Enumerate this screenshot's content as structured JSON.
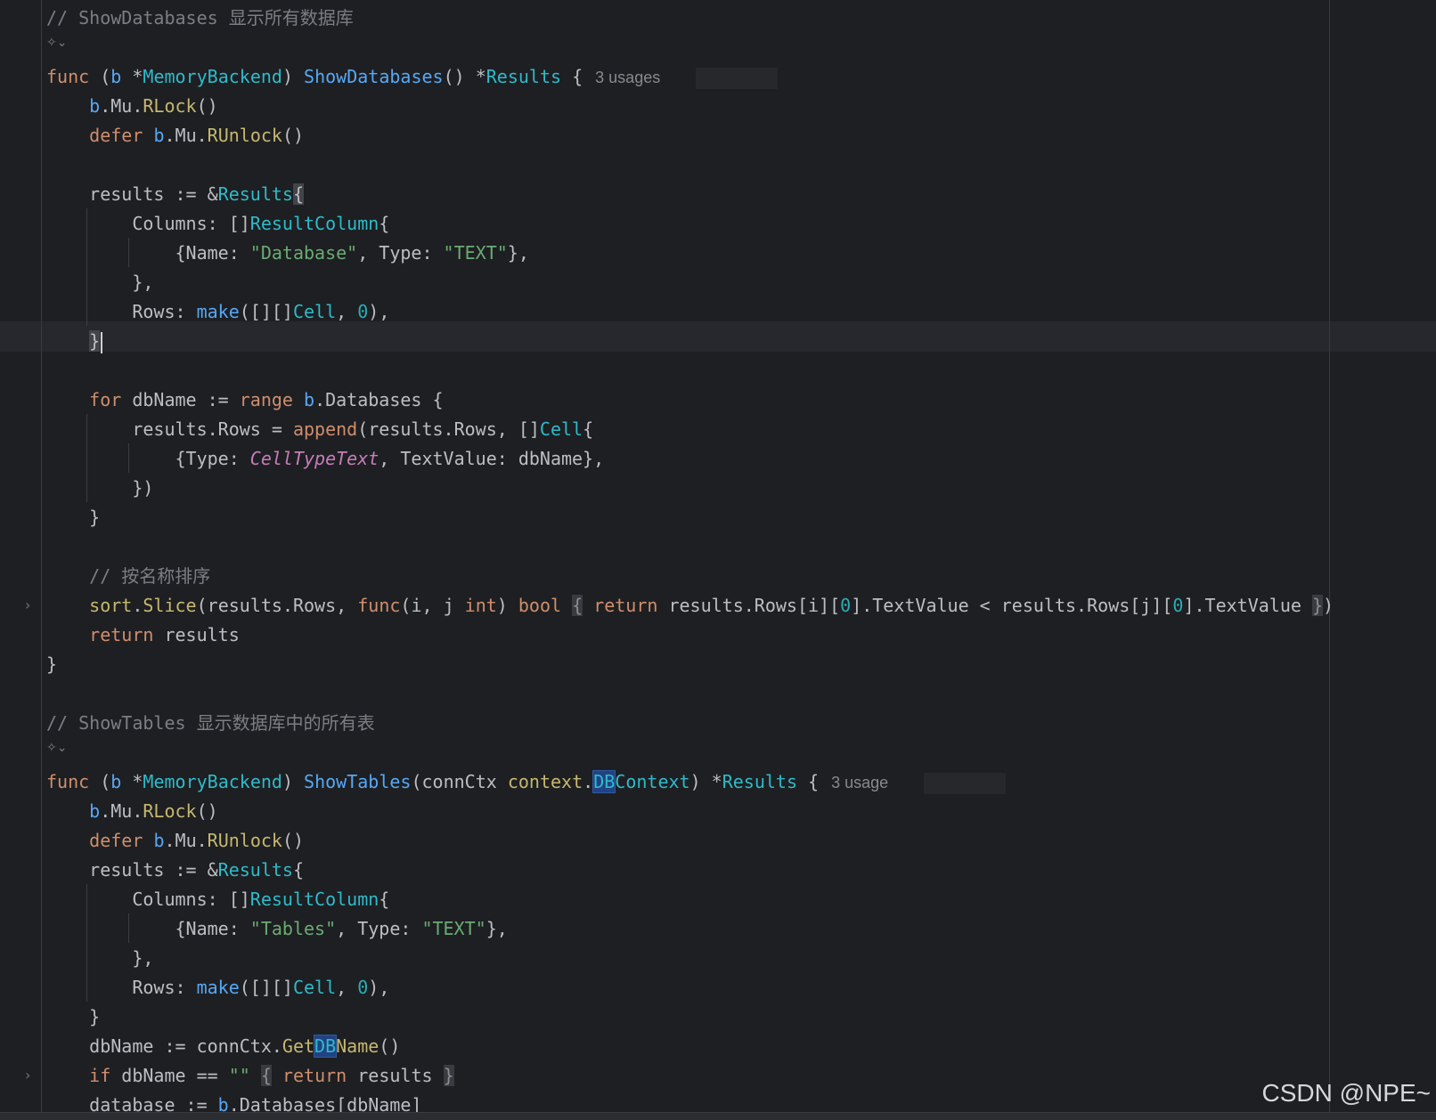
{
  "editor": {
    "lines": [
      {
        "t": 0,
        "cls": "cmt",
        "text": "// ShowDatabases 显示所有数据库"
      },
      {
        "t": 2,
        "seg": [
          [
            "kw",
            "func"
          ],
          [
            "p",
            " ("
          ],
          [
            "rcv",
            "b"
          ],
          [
            "p",
            " *"
          ],
          [
            "ty",
            "MemoryBackend"
          ],
          [
            "p",
            ") "
          ],
          [
            "fn",
            "ShowDatabases"
          ],
          [
            "p",
            "() *"
          ],
          [
            "ty",
            "Results"
          ],
          [
            "p",
            " {"
          ]
        ],
        "hint": "3 usages"
      },
      {
        "t": 3,
        "seg": [
          [
            "p",
            "    "
          ],
          [
            "rcv",
            "b"
          ],
          [
            "p",
            ".Mu."
          ],
          [
            "mc",
            "RLock"
          ],
          [
            "p",
            "()"
          ]
        ]
      },
      {
        "t": 4,
        "seg": [
          [
            "p",
            "    "
          ],
          [
            "kw",
            "defer"
          ],
          [
            "p",
            " "
          ],
          [
            "rcv",
            "b"
          ],
          [
            "p",
            ".Mu."
          ],
          [
            "mc",
            "RUnlock"
          ],
          [
            "p",
            "()"
          ]
        ]
      },
      {
        "t": 6,
        "seg": [
          [
            "p",
            "    results := &"
          ],
          [
            "ty",
            "Results"
          ],
          [
            "bh",
            "{"
          ]
        ]
      },
      {
        "t": 7,
        "seg": [
          [
            "p",
            "        Columns: []"
          ],
          [
            "ty",
            "ResultColumn"
          ],
          [
            "p",
            "{"
          ]
        ]
      },
      {
        "t": 8,
        "seg": [
          [
            "p",
            "            {Name: "
          ],
          [
            "str",
            "\"Database\""
          ],
          [
            "p",
            ", Type: "
          ],
          [
            "str",
            "\"TEXT\""
          ],
          [
            "p",
            "},"
          ]
        ]
      },
      {
        "t": 9,
        "seg": [
          [
            "p",
            "        },"
          ]
        ]
      },
      {
        "t": 10,
        "seg": [
          [
            "p",
            "        Rows: "
          ],
          [
            "bi",
            "make"
          ],
          [
            "p",
            "([][]"
          ],
          [
            "ty",
            "Cell"
          ],
          [
            "p",
            ", "
          ],
          [
            "num",
            "0"
          ],
          [
            "p",
            "),"
          ]
        ]
      },
      {
        "t": 11,
        "seg": [
          [
            "p",
            "    "
          ],
          [
            "bh",
            "}"
          ]
        ],
        "caret": true
      },
      {
        "t": 13,
        "seg": [
          [
            "p",
            "    "
          ],
          [
            "kw",
            "for"
          ],
          [
            "p",
            " dbName := "
          ],
          [
            "kw",
            "range"
          ],
          [
            "p",
            " "
          ],
          [
            "rcv",
            "b"
          ],
          [
            "p",
            ".Databases {"
          ]
        ]
      },
      {
        "t": 14,
        "seg": [
          [
            "p",
            "        results.Rows = "
          ],
          [
            "ap",
            "append"
          ],
          [
            "p",
            "(results.Rows, []"
          ],
          [
            "ty",
            "Cell"
          ],
          [
            "p",
            "{"
          ]
        ]
      },
      {
        "t": 15,
        "seg": [
          [
            "p",
            "            {Type: "
          ],
          [
            "cnst",
            "CellTypeText"
          ],
          [
            "p",
            ", TextValue: dbName},"
          ]
        ]
      },
      {
        "t": 16,
        "seg": [
          [
            "p",
            "        })"
          ]
        ]
      },
      {
        "t": 17,
        "seg": [
          [
            "p",
            "    }"
          ]
        ]
      },
      {
        "t": 19,
        "seg": [
          [
            "p",
            "    "
          ],
          [
            "cmt",
            "// 按名称排序"
          ]
        ]
      },
      {
        "t": 20,
        "fold": true,
        "seg": [
          [
            "p",
            "    "
          ],
          [
            "pkg",
            "sort"
          ],
          [
            "p",
            "."
          ],
          [
            "mc",
            "Slice"
          ],
          [
            "p",
            "(results.Rows, "
          ],
          [
            "kw",
            "func"
          ],
          [
            "p",
            "(i, j "
          ],
          [
            "kw",
            "int"
          ],
          [
            "p",
            ") "
          ],
          [
            "kw",
            "bool"
          ],
          [
            "p",
            " "
          ],
          [
            "fb",
            "{"
          ],
          [
            "p",
            " "
          ],
          [
            "kw",
            "return"
          ],
          [
            "p",
            " results.Rows[i]["
          ],
          [
            "num",
            "0"
          ],
          [
            "p",
            "].TextValue < results.Rows[j]["
          ],
          [
            "num",
            "0"
          ],
          [
            "p",
            "].TextValue "
          ],
          [
            "fb",
            "}"
          ],
          [
            "p",
            ")"
          ]
        ]
      },
      {
        "t": 21,
        "seg": [
          [
            "p",
            "    "
          ],
          [
            "kw",
            "return"
          ],
          [
            "p",
            " results"
          ]
        ]
      },
      {
        "t": 22,
        "seg": [
          [
            "p",
            "}"
          ]
        ]
      },
      {
        "t": 24,
        "cls": "cmt",
        "text": "// ShowTables 显示数据库中的所有表"
      },
      {
        "t": 26,
        "seg": [
          [
            "kw",
            "func"
          ],
          [
            "p",
            " ("
          ],
          [
            "rcv",
            "b"
          ],
          [
            "p",
            " *"
          ],
          [
            "ty",
            "MemoryBackend"
          ],
          [
            "p",
            ") "
          ],
          [
            "fn",
            "ShowTables"
          ],
          [
            "p",
            "(connCtx "
          ],
          [
            "pkg",
            "context"
          ],
          [
            "p",
            "."
          ],
          [
            "sh",
            "DB"
          ],
          [
            "ty",
            "Context"
          ],
          [
            "p",
            ") *"
          ],
          [
            "ty",
            "Results"
          ],
          [
            "p",
            " {"
          ]
        ],
        "hint": "3 usage"
      },
      {
        "t": 27,
        "seg": [
          [
            "p",
            "    "
          ],
          [
            "rcv",
            "b"
          ],
          [
            "p",
            ".Mu."
          ],
          [
            "mc",
            "RLock"
          ],
          [
            "p",
            "()"
          ]
        ]
      },
      {
        "t": 28,
        "seg": [
          [
            "p",
            "    "
          ],
          [
            "kw",
            "defer"
          ],
          [
            "p",
            " "
          ],
          [
            "rcv",
            "b"
          ],
          [
            "p",
            ".Mu."
          ],
          [
            "mc",
            "RUnlock"
          ],
          [
            "p",
            "()"
          ]
        ]
      },
      {
        "t": 29,
        "seg": [
          [
            "p",
            "    results := &"
          ],
          [
            "ty",
            "Results"
          ],
          [
            "p",
            "{"
          ]
        ]
      },
      {
        "t": 30,
        "seg": [
          [
            "p",
            "        Columns: []"
          ],
          [
            "ty",
            "ResultColumn"
          ],
          [
            "p",
            "{"
          ]
        ]
      },
      {
        "t": 31,
        "seg": [
          [
            "p",
            "            {Name: "
          ],
          [
            "str",
            "\"Tables\""
          ],
          [
            "p",
            ", Type: "
          ],
          [
            "str",
            "\"TEXT\""
          ],
          [
            "p",
            "},"
          ]
        ]
      },
      {
        "t": 32,
        "seg": [
          [
            "p",
            "        },"
          ]
        ]
      },
      {
        "t": 33,
        "seg": [
          [
            "p",
            "        Rows: "
          ],
          [
            "bi",
            "make"
          ],
          [
            "p",
            "([][]"
          ],
          [
            "ty",
            "Cell"
          ],
          [
            "p",
            ", "
          ],
          [
            "num",
            "0"
          ],
          [
            "p",
            "),"
          ]
        ]
      },
      {
        "t": 34,
        "seg": [
          [
            "p",
            "    }"
          ]
        ]
      },
      {
        "t": 35,
        "seg": [
          [
            "p",
            "    dbName := connCtx."
          ],
          [
            "mc",
            "Get"
          ],
          [
            "sh",
            "DB"
          ],
          [
            "mc",
            "Name"
          ],
          [
            "p",
            "()"
          ]
        ]
      },
      {
        "t": 36,
        "fold": true,
        "seg": [
          [
            "p",
            "    "
          ],
          [
            "kw",
            "if"
          ],
          [
            "p",
            " dbName == "
          ],
          [
            "str",
            "\"\""
          ],
          [
            "p",
            " "
          ],
          [
            "fb",
            "{"
          ],
          [
            "p",
            " "
          ],
          [
            "kw",
            "return"
          ],
          [
            "p",
            " results "
          ],
          [
            "fb",
            "}"
          ]
        ]
      },
      {
        "t": 37,
        "seg": [
          [
            "p",
            "    database := "
          ],
          [
            "rcv",
            "b"
          ],
          [
            "p",
            ".Databases[dbName]"
          ]
        ]
      }
    ],
    "ai_icons": [
      1,
      25
    ],
    "ai_icon_glyph": "✧⌄"
  },
  "watermark": "CSDN @NPE~",
  "colors": {
    "background": "#1e1f22",
    "keyword": "#cf8e6d",
    "function": "#56a8f5",
    "type": "#2fbaca",
    "string": "#6aab73",
    "comment": "#7a7e85",
    "number": "#2aacb8"
  }
}
